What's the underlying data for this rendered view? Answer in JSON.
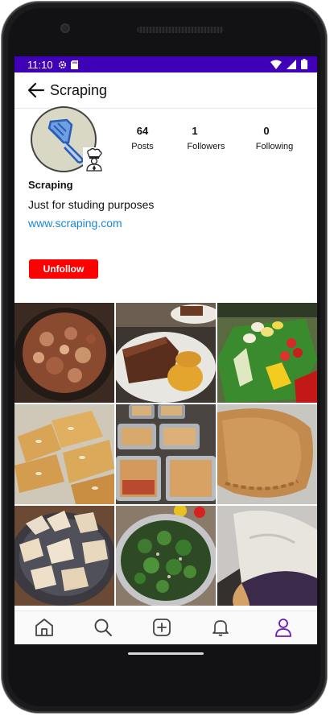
{
  "status_bar": {
    "time": "11:10"
  },
  "app_bar": {
    "title": "Scraping"
  },
  "profile": {
    "stats": [
      {
        "value": "64",
        "label": "Posts"
      },
      {
        "value": "1",
        "label": "Followers"
      },
      {
        "value": "0",
        "label": "Following"
      }
    ],
    "name": "Scraping",
    "bio": "Just for studing purposes",
    "website": "www.scraping.com",
    "unfollow_label": "Unfollow"
  },
  "colors": {
    "status_bar": "#3f00b8",
    "unfollow": "#ff0000",
    "link": "#1a86d8",
    "nav_active": "#6a1bb8"
  },
  "posts": [
    {
      "icon": "stew-photo"
    },
    {
      "icon": "meat-dish-photo"
    },
    {
      "icon": "salad-platter-photo"
    },
    {
      "icon": "almond-bars-photo"
    },
    {
      "icon": "casserole-trays-photo"
    },
    {
      "icon": "pastry-photo"
    },
    {
      "icon": "wontons-photo"
    },
    {
      "icon": "broccoli-salad-photo"
    },
    {
      "icon": "pie-photo"
    }
  ],
  "nav_items": [
    {
      "icon": "home-icon"
    },
    {
      "icon": "search-icon"
    },
    {
      "icon": "add-post-icon"
    },
    {
      "icon": "bell-icon"
    },
    {
      "icon": "profile-icon"
    }
  ]
}
